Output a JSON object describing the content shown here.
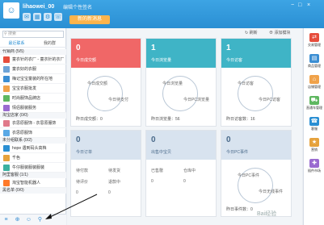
{
  "titlebar": {
    "username": "lihaowei_00",
    "signature": "编辑个性签名",
    "new_message_tab": "新的新消息"
  },
  "left": {
    "search_placeholder": "搜索",
    "tabs": [
      "最近联系",
      "我的群"
    ],
    "groups": [
      {
        "label": "代销商 (5/5)",
        "items": [
          {
            "text": "童衣针的衣厂 - 童衣针的衣厂",
            "color": "#e64d3c"
          },
          {
            "text": "童衣好的衣服",
            "color": "#6da3d6"
          },
          {
            "text": "梅记宝宝童装的所在地",
            "color": "#3b8ed3"
          },
          {
            "text": "宝宝衣服批发",
            "color": "#f0a24a"
          },
          {
            "text": "时尚服饰品牌店",
            "color": "#5fb760"
          },
          {
            "text": "情侣服装服务",
            "color": "#9a6bd0"
          }
        ]
      },
      {
        "label": "淘宝店家 (0/0)",
        "items": [
          {
            "text": "衣思原服饰 - 衣思原服饰",
            "color": "#e07a8a"
          },
          {
            "text": "衣思原服饰",
            "color": "#5aa9e6"
          }
        ]
      },
      {
        "label": "未分组联系 (0/2)",
        "items": [
          {
            "text": "hope 遇到码头高档",
            "color": "#2a8fd3"
          },
          {
            "text": "千色",
            "color": "#e6a23c"
          },
          {
            "text": "牛仔服装服装服装",
            "color": "#3ab0a0"
          }
        ]
      },
      {
        "label": "阿里客服 (1/1)",
        "items": [
          {
            "text": "淘宝智能机器人",
            "color": "#ff7a2a"
          }
        ]
      },
      {
        "label": "黑名单 (0/0)",
        "items": []
      }
    ]
  },
  "main": {
    "refresh": "刷新",
    "add_feed": "添加模块",
    "cards": [
      {
        "num": "0",
        "label": "今日成交额",
        "color": "#f06767",
        "foot": "昨日成交额：0",
        "ring": "今日成交额",
        "ring2": "今日待支付"
      },
      {
        "num": "1",
        "label": "今日浏览量",
        "color": "#3fb4c6",
        "foot": "昨日浏览量：56",
        "ring": "今日浏览量",
        "ring2": "今日PC浏览量"
      },
      {
        "num": "1",
        "label": "今日访客",
        "color": "#3fb4c6",
        "foot": "昨日访客数：16",
        "ring": "今日访客",
        "ring2": "今日PC访客"
      },
      {
        "num": "0",
        "label": "今日订单",
        "color": "#d8e3ef",
        "rows": [
          [
            "待付款",
            "待发货"
          ],
          [
            "待评价",
            "退款中"
          ],
          [
            "0",
            "0"
          ]
        ]
      },
      {
        "num": "0",
        "label": "出售中宝贝",
        "color": "#d8e3ef",
        "rows": [
          [
            "已售罄",
            "仓库中"
          ],
          [
            "0",
            "0"
          ]
        ]
      },
      {
        "num": "0",
        "label": "今日PC事件",
        "color": "#d8e3ef",
        "ring": "今日PC事件",
        "ring2": "今日无线事件",
        "foot": "昨日事件数：0"
      }
    ]
  },
  "rightbar": {
    "items": [
      {
        "label": "交易管理",
        "color": "#e64d3c"
      },
      {
        "label": "商品管理",
        "color": "#3b8ed3"
      },
      {
        "label": "店铺管理",
        "color": "#f0a24a"
      },
      {
        "label": "直通车管理",
        "color": "#5fb760"
      },
      {
        "label": "客服",
        "color": "#2a8fd3"
      },
      {
        "label": "营销",
        "color": "#e6a23c"
      },
      {
        "label": "插件市场",
        "color": "#9a6bd0"
      }
    ]
  },
  "watermark": "Bai经验"
}
